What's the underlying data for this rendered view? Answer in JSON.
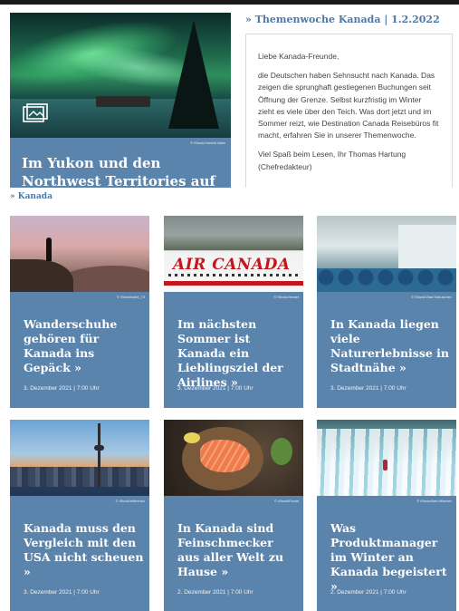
{
  "hero": {
    "credit": "© iStock/Yarnick Allan",
    "title": "Im Yukon und den Northwest Territories auf Nordlichter-Jagd",
    "icon": "gallery-icon"
  },
  "themenwoche": {
    "heading": "» Themenwoche Kanada | 1.2.2022",
    "greeting": "Liebe Kanada-Freunde,",
    "body": "die Deutschen haben Sehnsucht nach Kanada. Das zeigen die sprunghaft gestiegenen Buchungen seit Öffnung der Grenze. Selbst kurzfristig im Winter zieht es viele über den Teich. Was dort jetzt und im Sommer reizt, wie Destination Canada Reisebüros fit macht, erfahren Sie in unserer Themenwoche.",
    "signoff": "Viel Spaß beim Lesen, Ihr Thomas Hartung (Chefredakteur)"
  },
  "section": {
    "heading": "» Kanada"
  },
  "cards": [
    {
      "title": "Wanderschuhe gehören für Kanada ins Gepäck »",
      "date": "3. Dezember 2021 | 7:00 Uhr",
      "credit": "© iStock/solid_73"
    },
    {
      "title": "Im nächsten Sommer ist Kanada ein Lieblingsziel der Airlines »",
      "date": "3. Dezember 2021 | 7:00 Uhr",
      "credit": "© iStock/Imnart",
      "image_text": "AIR CANADA"
    },
    {
      "title": "In Kanada liegen viele Naturerlebnisse in Stadtnähe »",
      "date": "3. Dezember 2021 | 7:00 Uhr",
      "credit": "© iStock/Vlad Sokuschev"
    },
    {
      "title": "Kanada muss den Vergleich mit den USA nicht scheuen »",
      "date": "3. Dezember 2021 | 7:00 Uhr",
      "credit": "© iStock/mitrienko"
    },
    {
      "title": "In Kanada sind Feinschmecker aus aller Welt zu Hause »",
      "date": "2. Dezember 2021 | 7:00 Uhr",
      "credit": "© iStock/Fuchs"
    },
    {
      "title": "Was Produktmanager im Winter an Kanada begeistert »",
      "date": "2. Dezember 2021 | 7:00 Uhr",
      "credit": "© iStock/Bob Hilscher"
    }
  ],
  "colors": {
    "card_blue": "#5b84ad",
    "link_blue": "#4c79a8"
  }
}
